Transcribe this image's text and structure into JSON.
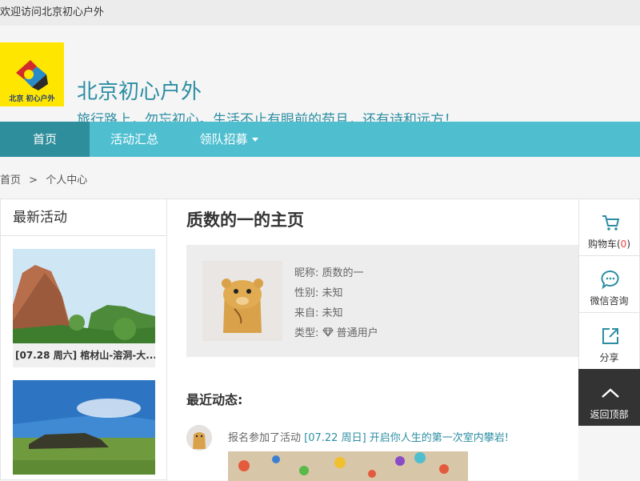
{
  "topbar": {
    "welcome": "欢迎访问北京初心户外"
  },
  "header": {
    "title": "北京初心户外",
    "slogan": "旅行路上，勿忘初心。生活不止有眼前的苟且，还有诗和远方！",
    "logo_text": "北京初心户外"
  },
  "nav": {
    "items": [
      {
        "label": "首页"
      },
      {
        "label": "活动汇总"
      },
      {
        "label": "领队招募"
      }
    ]
  },
  "breadcrumb": {
    "home": "首页",
    "sep": ">",
    "current": "个人中心"
  },
  "left": {
    "title": "最新活动",
    "cards": [
      {
        "caption": "[07.28 周六] 棺材山-溶洞-大..."
      },
      {
        "caption": ""
      }
    ]
  },
  "profile": {
    "page_title": "质数的一的主页",
    "nickname_label": "昵称:",
    "nickname": "质数的一",
    "gender_label": "性别:",
    "gender": "未知",
    "from_label": "来自:",
    "from": "未知",
    "type_label": "类型:",
    "type": "普通用户"
  },
  "recent": {
    "title": "最近动态:",
    "items": [
      {
        "prefix": "报名参加了活动",
        "link": "[07.22 周日] 开启你人生的第一次室内攀岩!"
      }
    ]
  },
  "side": {
    "cart_label": "购物车(",
    "cart_count": "0",
    "cart_close": ")",
    "consult_label": "微信咨询",
    "share_label": "分享",
    "top_label": "返回顶部"
  },
  "colors": {
    "accent": "#4fbfd0",
    "accent_dark": "#2f8e9c",
    "link": "#2d8ea3",
    "logo_bg": "#ffe600"
  },
  "icons": [
    "cart-icon",
    "wechat-icon",
    "share-icon",
    "chevron-up-icon",
    "diamond-icon"
  ]
}
